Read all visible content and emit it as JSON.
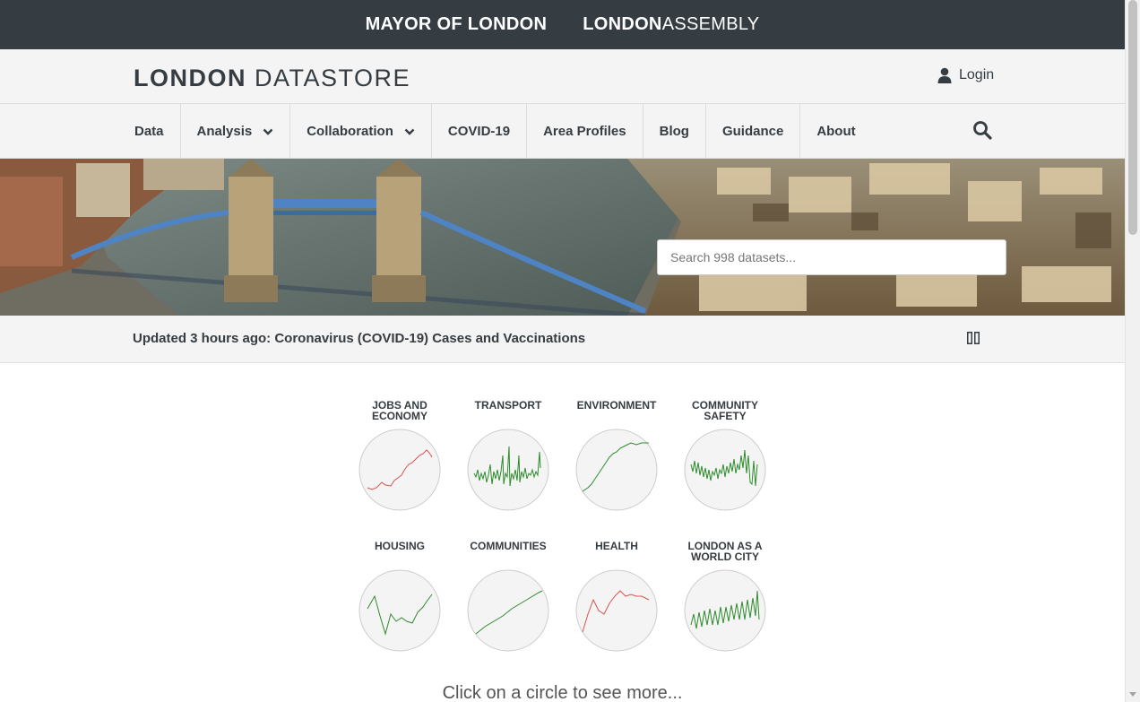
{
  "topbar": {
    "mayor_label": "MAYOR OF LONDON",
    "assembly_bold": "LONDON",
    "assembly_rest": "ASSEMBLY"
  },
  "header": {
    "logo_bold": "LONDON",
    "logo_rest": "DATASTORE",
    "login_label": "Login",
    "login_icon": "user-icon"
  },
  "nav": {
    "items": [
      {
        "label": "Data",
        "has_dropdown": false
      },
      {
        "label": "Analysis",
        "has_dropdown": true
      },
      {
        "label": "Collaboration",
        "has_dropdown": true
      },
      {
        "label": "COVID-19",
        "has_dropdown": false
      },
      {
        "label": "Area Profiles",
        "has_dropdown": false
      },
      {
        "label": "Blog",
        "has_dropdown": false
      },
      {
        "label": "Guidance",
        "has_dropdown": false
      },
      {
        "label": "About",
        "has_dropdown": false
      }
    ],
    "search_icon": "search-icon"
  },
  "hero": {
    "search_placeholder": "Search 998 datasets..."
  },
  "updated": {
    "text": "Updated 3 hours ago: Coronavirus (COVID-19) Cases and Vaccinations",
    "pause_icon": "pause-icon"
  },
  "themes": [
    {
      "label": "JOBS AND ECONOMY",
      "trend_color": "#d9534f"
    },
    {
      "label": "TRANSPORT",
      "trend_color": "#2e8b2e"
    },
    {
      "label": "ENVIRONMENT",
      "trend_color": "#2e8b2e"
    },
    {
      "label": "COMMUNITY SAFETY",
      "trend_color": "#2e8b2e"
    },
    {
      "label": "HOUSING",
      "trend_color": "#2e8b2e"
    },
    {
      "label": "COMMUNITIES",
      "trend_color": "#2e8b2e"
    },
    {
      "label": "HEALTH",
      "trend_color": "#d9534f"
    },
    {
      "label": "LONDON AS A WORLD CITY",
      "trend_color": "#2e8b2e"
    }
  ],
  "footer_hint": "Click on a circle to see more...",
  "colors": {
    "dark": "#353d42",
    "light_bg": "#f4f4f4",
    "trend_up_green": "#2e8b2e",
    "trend_red": "#d9534f"
  }
}
